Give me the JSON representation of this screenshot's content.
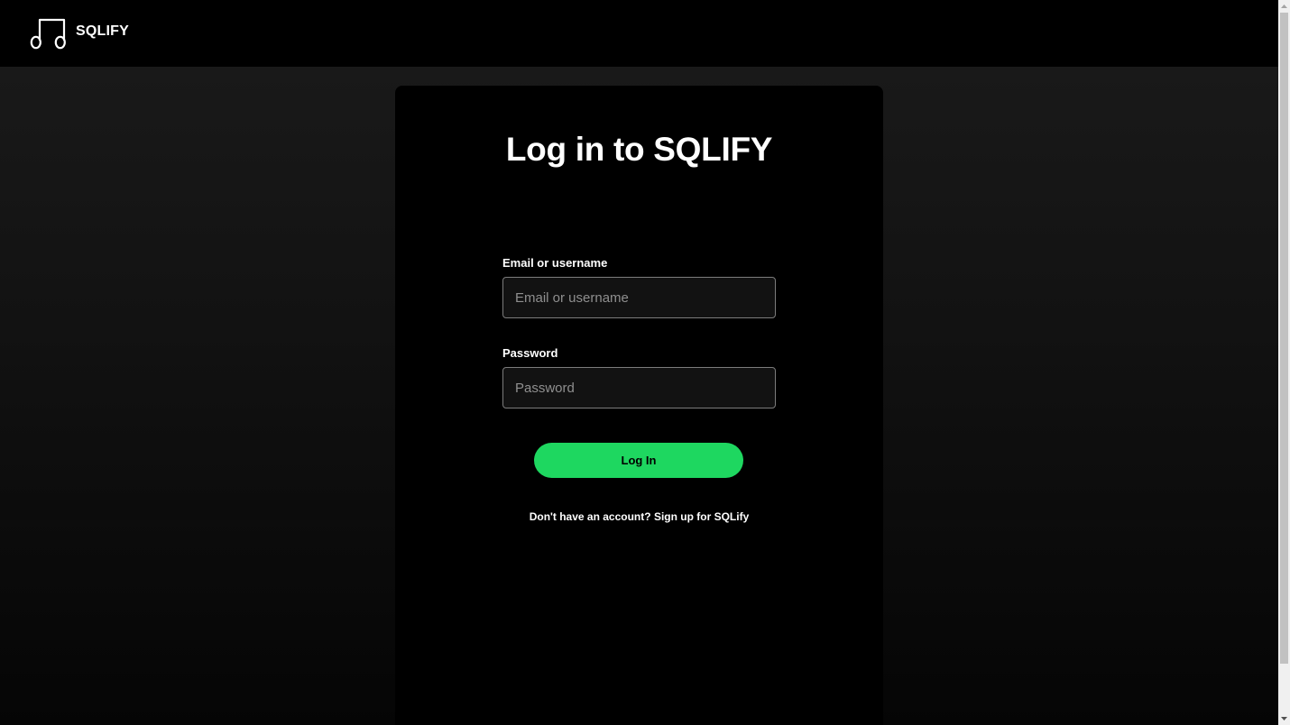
{
  "app": {
    "brand": "SQLIFY",
    "logo_icon": "music-note-icon"
  },
  "login": {
    "title": "Log in to SQLIFY",
    "email_label": "Email or username",
    "email_placeholder": "Email or username",
    "email_value": "",
    "password_label": "Password",
    "password_placeholder": "Password",
    "password_value": "",
    "submit_label": "Log In",
    "signup_prompt": "Don't have an account?",
    "signup_link": "Sign up for SQLify"
  },
  "colors": {
    "accent": "#1ed760",
    "background": "#000000",
    "card": "#000000",
    "input_bg": "#121212"
  }
}
